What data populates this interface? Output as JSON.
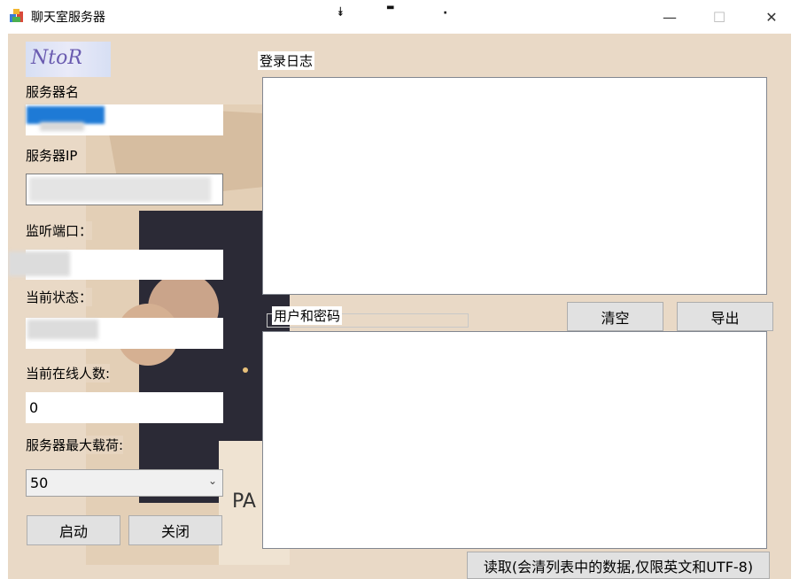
{
  "window": {
    "title": "聊天室服务器",
    "minimize": "—",
    "maximize": "☐",
    "close": "✕",
    "toolbar_glyphs": [
      "⯯",
      "▬",
      "·"
    ]
  },
  "logo": {
    "text": "NtoR"
  },
  "left_panel": {
    "server_name_label": "服务器名",
    "server_name_value": "",
    "server_ip_label": "服务器IP",
    "server_ip_value": "",
    "listen_port_label": "监听端口：",
    "listen_port_value": "",
    "status_label": "当前状态：",
    "status_value": "",
    "online_count_label": "当前在线人数:",
    "online_count_value": "0",
    "max_load_label": "服务器最大载荷:",
    "max_load_selected": "50",
    "start_button": "启动",
    "close_button": "关闭"
  },
  "right_panel": {
    "login_log_label": "登录日志",
    "users_label": "用户和密码",
    "clear_button": "清空",
    "export_button": "导出",
    "read_button": "读取(会清列表中的数据,仅限英文和UTF-8)"
  },
  "colors": {
    "background": "#e9d9c6",
    "selection_blue": "#1e7ad6",
    "button_face": "#e1e1e1"
  }
}
